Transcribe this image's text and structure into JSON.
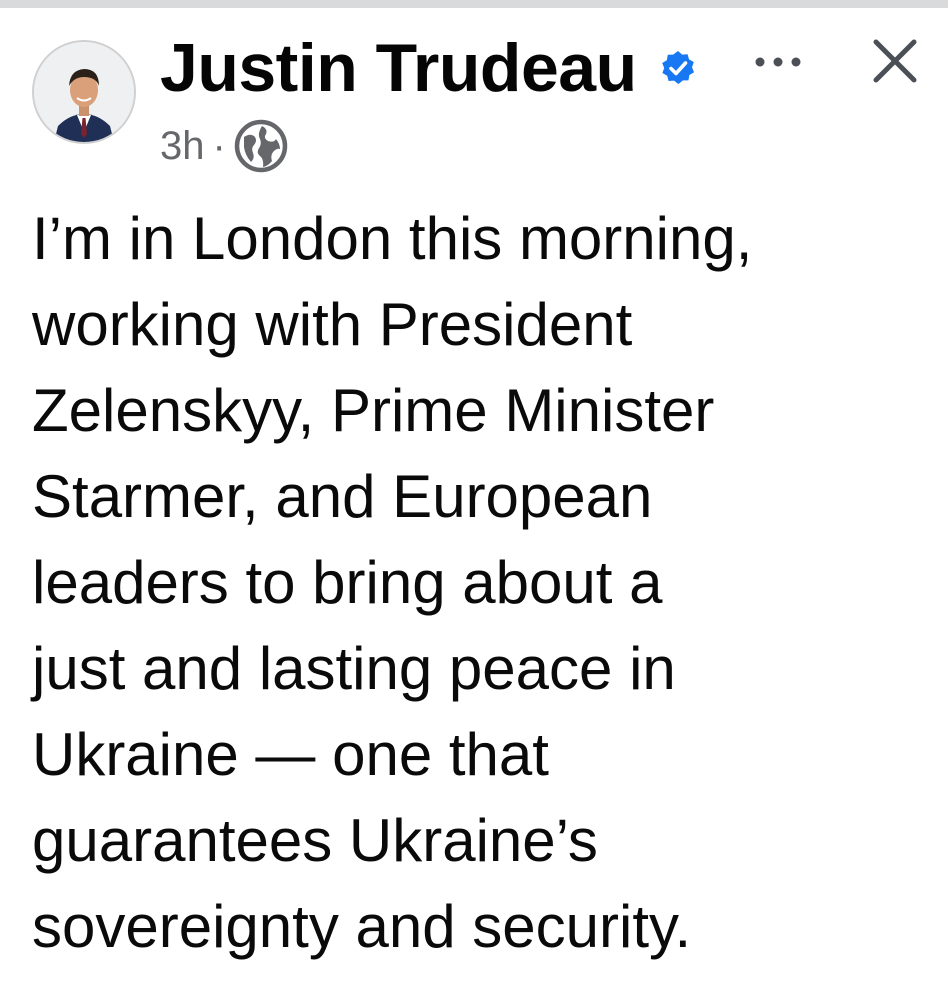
{
  "post": {
    "author": {
      "name": "Justin Trudeau",
      "verified": true,
      "avatar": "profile-photo"
    },
    "timestamp": "3h",
    "separator": "·",
    "audience_icon": "globe-icon",
    "text": "I’m in London this morning,\nworking with President\nZelenskyy, Prime Minister\nStarmer, and European\nleaders to bring about a\njust and lasting peace in\nUkraine — one that\nguarantees Ukraine’s\nsovereignty and security."
  },
  "actions": {
    "more_icon": "more-options-icon",
    "close_icon": "close-icon"
  },
  "colors": {
    "verified_blue": "#1877f2",
    "meta_gray": "#65676b",
    "text": "#0a0a0a"
  }
}
